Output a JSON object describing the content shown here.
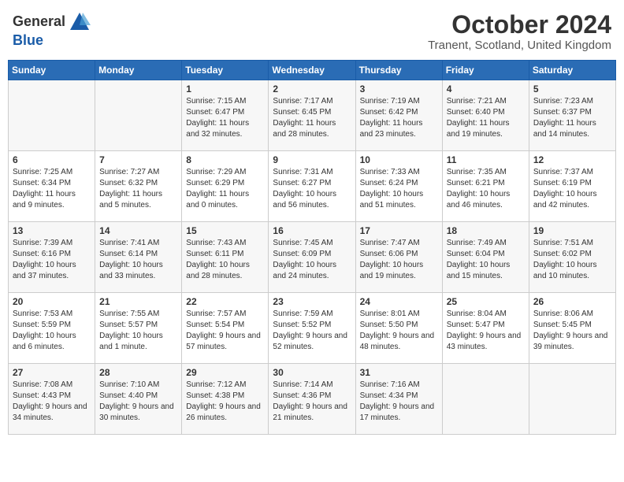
{
  "logo": {
    "general": "General",
    "blue": "Blue"
  },
  "header": {
    "month": "October 2024",
    "location": "Tranent, Scotland, United Kingdom"
  },
  "days_of_week": [
    "Sunday",
    "Monday",
    "Tuesday",
    "Wednesday",
    "Thursday",
    "Friday",
    "Saturday"
  ],
  "weeks": [
    [
      {
        "day": "",
        "sunrise": "",
        "sunset": "",
        "daylight": ""
      },
      {
        "day": "",
        "sunrise": "",
        "sunset": "",
        "daylight": ""
      },
      {
        "day": "1",
        "sunrise": "Sunrise: 7:15 AM",
        "sunset": "Sunset: 6:47 PM",
        "daylight": "Daylight: 11 hours and 32 minutes."
      },
      {
        "day": "2",
        "sunrise": "Sunrise: 7:17 AM",
        "sunset": "Sunset: 6:45 PM",
        "daylight": "Daylight: 11 hours and 28 minutes."
      },
      {
        "day": "3",
        "sunrise": "Sunrise: 7:19 AM",
        "sunset": "Sunset: 6:42 PM",
        "daylight": "Daylight: 11 hours and 23 minutes."
      },
      {
        "day": "4",
        "sunrise": "Sunrise: 7:21 AM",
        "sunset": "Sunset: 6:40 PM",
        "daylight": "Daylight: 11 hours and 19 minutes."
      },
      {
        "day": "5",
        "sunrise": "Sunrise: 7:23 AM",
        "sunset": "Sunset: 6:37 PM",
        "daylight": "Daylight: 11 hours and 14 minutes."
      }
    ],
    [
      {
        "day": "6",
        "sunrise": "Sunrise: 7:25 AM",
        "sunset": "Sunset: 6:34 PM",
        "daylight": "Daylight: 11 hours and 9 minutes."
      },
      {
        "day": "7",
        "sunrise": "Sunrise: 7:27 AM",
        "sunset": "Sunset: 6:32 PM",
        "daylight": "Daylight: 11 hours and 5 minutes."
      },
      {
        "day": "8",
        "sunrise": "Sunrise: 7:29 AM",
        "sunset": "Sunset: 6:29 PM",
        "daylight": "Daylight: 11 hours and 0 minutes."
      },
      {
        "day": "9",
        "sunrise": "Sunrise: 7:31 AM",
        "sunset": "Sunset: 6:27 PM",
        "daylight": "Daylight: 10 hours and 56 minutes."
      },
      {
        "day": "10",
        "sunrise": "Sunrise: 7:33 AM",
        "sunset": "Sunset: 6:24 PM",
        "daylight": "Daylight: 10 hours and 51 minutes."
      },
      {
        "day": "11",
        "sunrise": "Sunrise: 7:35 AM",
        "sunset": "Sunset: 6:21 PM",
        "daylight": "Daylight: 10 hours and 46 minutes."
      },
      {
        "day": "12",
        "sunrise": "Sunrise: 7:37 AM",
        "sunset": "Sunset: 6:19 PM",
        "daylight": "Daylight: 10 hours and 42 minutes."
      }
    ],
    [
      {
        "day": "13",
        "sunrise": "Sunrise: 7:39 AM",
        "sunset": "Sunset: 6:16 PM",
        "daylight": "Daylight: 10 hours and 37 minutes."
      },
      {
        "day": "14",
        "sunrise": "Sunrise: 7:41 AM",
        "sunset": "Sunset: 6:14 PM",
        "daylight": "Daylight: 10 hours and 33 minutes."
      },
      {
        "day": "15",
        "sunrise": "Sunrise: 7:43 AM",
        "sunset": "Sunset: 6:11 PM",
        "daylight": "Daylight: 10 hours and 28 minutes."
      },
      {
        "day": "16",
        "sunrise": "Sunrise: 7:45 AM",
        "sunset": "Sunset: 6:09 PM",
        "daylight": "Daylight: 10 hours and 24 minutes."
      },
      {
        "day": "17",
        "sunrise": "Sunrise: 7:47 AM",
        "sunset": "Sunset: 6:06 PM",
        "daylight": "Daylight: 10 hours and 19 minutes."
      },
      {
        "day": "18",
        "sunrise": "Sunrise: 7:49 AM",
        "sunset": "Sunset: 6:04 PM",
        "daylight": "Daylight: 10 hours and 15 minutes."
      },
      {
        "day": "19",
        "sunrise": "Sunrise: 7:51 AM",
        "sunset": "Sunset: 6:02 PM",
        "daylight": "Daylight: 10 hours and 10 minutes."
      }
    ],
    [
      {
        "day": "20",
        "sunrise": "Sunrise: 7:53 AM",
        "sunset": "Sunset: 5:59 PM",
        "daylight": "Daylight: 10 hours and 6 minutes."
      },
      {
        "day": "21",
        "sunrise": "Sunrise: 7:55 AM",
        "sunset": "Sunset: 5:57 PM",
        "daylight": "Daylight: 10 hours and 1 minute."
      },
      {
        "day": "22",
        "sunrise": "Sunrise: 7:57 AM",
        "sunset": "Sunset: 5:54 PM",
        "daylight": "Daylight: 9 hours and 57 minutes."
      },
      {
        "day": "23",
        "sunrise": "Sunrise: 7:59 AM",
        "sunset": "Sunset: 5:52 PM",
        "daylight": "Daylight: 9 hours and 52 minutes."
      },
      {
        "day": "24",
        "sunrise": "Sunrise: 8:01 AM",
        "sunset": "Sunset: 5:50 PM",
        "daylight": "Daylight: 9 hours and 48 minutes."
      },
      {
        "day": "25",
        "sunrise": "Sunrise: 8:04 AM",
        "sunset": "Sunset: 5:47 PM",
        "daylight": "Daylight: 9 hours and 43 minutes."
      },
      {
        "day": "26",
        "sunrise": "Sunrise: 8:06 AM",
        "sunset": "Sunset: 5:45 PM",
        "daylight": "Daylight: 9 hours and 39 minutes."
      }
    ],
    [
      {
        "day": "27",
        "sunrise": "Sunrise: 7:08 AM",
        "sunset": "Sunset: 4:43 PM",
        "daylight": "Daylight: 9 hours and 34 minutes."
      },
      {
        "day": "28",
        "sunrise": "Sunrise: 7:10 AM",
        "sunset": "Sunset: 4:40 PM",
        "daylight": "Daylight: 9 hours and 30 minutes."
      },
      {
        "day": "29",
        "sunrise": "Sunrise: 7:12 AM",
        "sunset": "Sunset: 4:38 PM",
        "daylight": "Daylight: 9 hours and 26 minutes."
      },
      {
        "day": "30",
        "sunrise": "Sunrise: 7:14 AM",
        "sunset": "Sunset: 4:36 PM",
        "daylight": "Daylight: 9 hours and 21 minutes."
      },
      {
        "day": "31",
        "sunrise": "Sunrise: 7:16 AM",
        "sunset": "Sunset: 4:34 PM",
        "daylight": "Daylight: 9 hours and 17 minutes."
      },
      {
        "day": "",
        "sunrise": "",
        "sunset": "",
        "daylight": ""
      },
      {
        "day": "",
        "sunrise": "",
        "sunset": "",
        "daylight": ""
      }
    ]
  ]
}
